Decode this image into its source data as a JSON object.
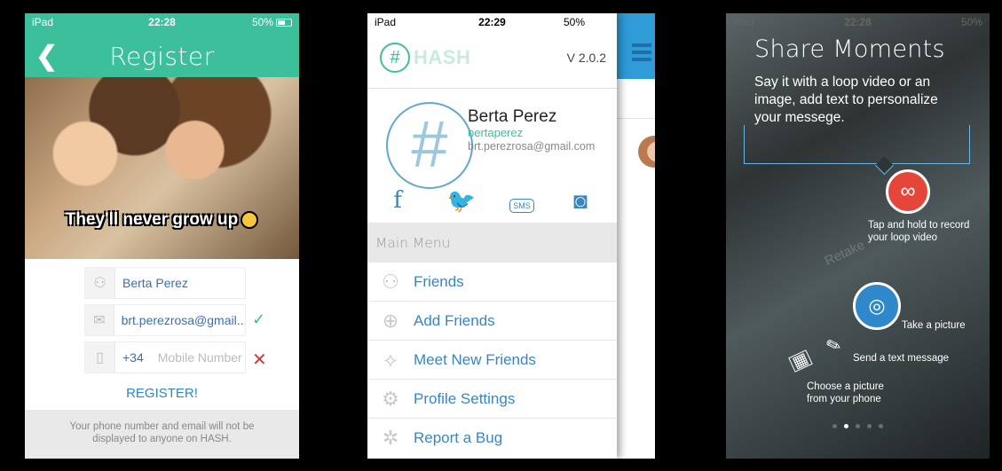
{
  "register": {
    "status": {
      "carrier": "iPad",
      "time": "22:28",
      "battery": "50%"
    },
    "title": "Register",
    "back_icon": "chevron-left-icon",
    "caption": "They'll never grow up",
    "name_value": "Berta Perez",
    "email_value": "brt.perezrosa@gmail....",
    "country_code": "+34",
    "mobile_placeholder": "Mobile Number",
    "register_label": "REGISTER!",
    "footer": "Your phone number and email will not be displayed to anyone on HASH.",
    "colors": {
      "header": "#3cbf9b",
      "link": "#2f86c6",
      "valid": "#3cbf9b",
      "invalid": "#e0303a"
    }
  },
  "menu": {
    "status": {
      "carrier": "iPad",
      "time": "22:29",
      "battery": "50%"
    },
    "logo_text": "HASH",
    "version": "V 2.0.2",
    "profile": {
      "name": "Berta Perez",
      "username": "bertaperez",
      "email": "brt.perezrosa@gmail.com"
    },
    "sms_label": "SMS",
    "section_title": "Main Menu",
    "items": [
      {
        "label": "Friends",
        "icon": "friends-icon"
      },
      {
        "label": "Add Friends",
        "icon": "add-friend-icon"
      },
      {
        "label": "Meet New Friends",
        "icon": "handshake-icon"
      },
      {
        "label": "Profile Settings",
        "icon": "gear-icon"
      },
      {
        "label": "Report a Bug",
        "icon": "bug-icon"
      }
    ]
  },
  "tutorial": {
    "status": {
      "carrier": "iPad",
      "time": "22:28",
      "battery": "50%"
    },
    "title": "Share Moments",
    "subtitle": "Say it with a loop video or an image, add text to personalize your messege.",
    "record_tip": "Tap and hold to record your loop video",
    "picture_tip": "Take a picture",
    "text_tip": "Send a text message",
    "choose_tip": "Choose a picture from your phone",
    "bg_word": "Retake",
    "page_count": 5,
    "active_page": 2
  }
}
